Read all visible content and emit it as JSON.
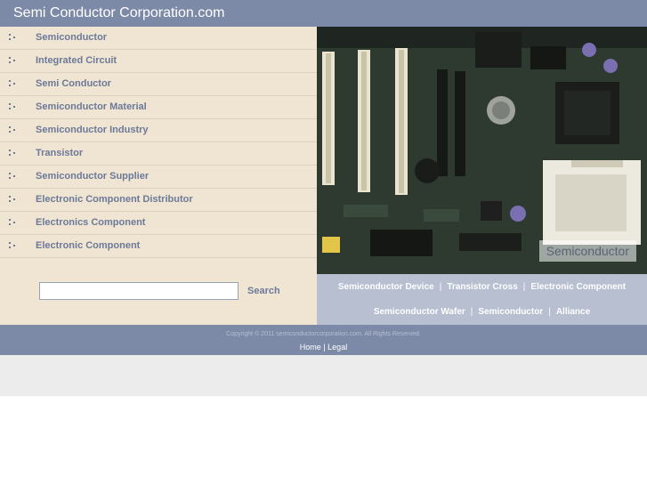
{
  "header": {
    "site_title": "Semi Conductor Corporation.com"
  },
  "sidebar": {
    "items": [
      {
        "label": "Semiconductor"
      },
      {
        "label": "Integrated Circuit"
      },
      {
        "label": "Semi Conductor"
      },
      {
        "label": "Semiconductor Material"
      },
      {
        "label": "Semiconductor Industry"
      },
      {
        "label": "Transistor"
      },
      {
        "label": "Semiconductor Supplier"
      },
      {
        "label": "Electronic Component Distributor"
      },
      {
        "label": "Electronics Component"
      },
      {
        "label": "Electronic Component"
      }
    ],
    "search": {
      "value": "",
      "button_label": "Search"
    }
  },
  "hero": {
    "caption": "Semiconductor"
  },
  "links_bar": {
    "row1": [
      "Semiconductor Device",
      "Transistor Cross",
      "Electronic Component"
    ],
    "row2": [
      "Semiconductor Wafer",
      "Semiconductor",
      "Alliance"
    ],
    "separator": "|"
  },
  "footer": {
    "copyright": "Copyright © 2011 semiconductorcorporation.com. All Rights Reserved.",
    "home_label": "Home",
    "separator": "|",
    "legal_label": "Legal"
  },
  "colors": {
    "header_bg": "#7d8aa7",
    "sidebar_bg": "#f0e4d2",
    "nav_text": "#6b7a99",
    "links_bar_bg": "#b7bfd1"
  }
}
